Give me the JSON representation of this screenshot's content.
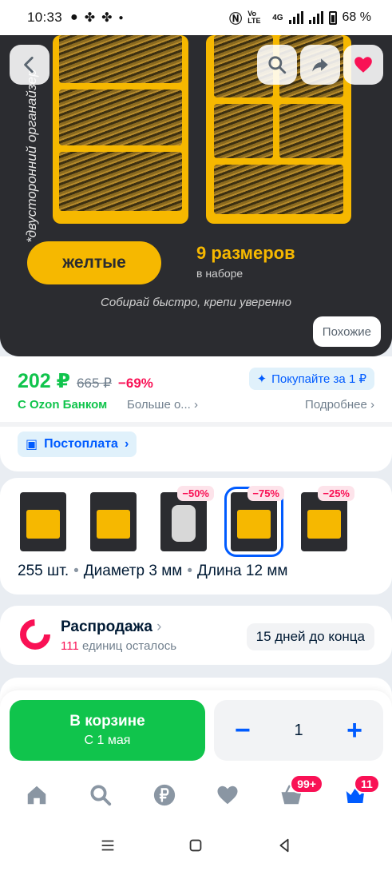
{
  "status_bar": {
    "time": "10:33",
    "battery": "68 %",
    "network": "4G",
    "volte": "Vo LTE"
  },
  "hero": {
    "side_text": "*двусторонний органайзер",
    "color_label": "желтые",
    "sizes_title": "9 размеров",
    "sizes_sub": "в наборе",
    "tagline": "Собирай быстро, крепи уверенно",
    "similar_button": "Похожие",
    "icons": [
      "back-icon",
      "search-icon",
      "share-icon",
      "favorite-heart-icon"
    ]
  },
  "price": {
    "current": "202 ₽",
    "old": "665 ₽",
    "discount": "−69%",
    "promo_button": "Покупайте за 1 ₽",
    "bank_label": "С Ozon Банком",
    "bank_more": "Больше о...",
    "details_link": "Подробнее",
    "postpay_button": "Постоплата"
  },
  "variants": {
    "thumbs": [
      {
        "badge": "",
        "kind": "yellow-box"
      },
      {
        "badge": "",
        "kind": "yellow-box"
      },
      {
        "badge": "−50%",
        "kind": "white-jar"
      },
      {
        "badge": "−75%",
        "kind": "yellow-box",
        "selected": true
      },
      {
        "badge": "−25%",
        "kind": "yellow-box"
      }
    ],
    "spec_count": "255 шт.",
    "spec_diameter": "Диаметр 3 мм",
    "spec_length": "Длина 12 мм"
  },
  "sale": {
    "title": "Распродажа",
    "remaining_count": "111",
    "remaining_text": "единиц осталось",
    "days_left": "15 дней до конца"
  },
  "actions": {
    "cart_label": "В корзине",
    "cart_sub": "С 1 мая",
    "quantity": "1",
    "minus": "−",
    "plus": "+"
  },
  "bottom_nav": {
    "cart_badge": "99+",
    "profile_badge": "11",
    "items": [
      "home-icon",
      "search-icon",
      "ruble-icon",
      "favorites-icon",
      "cart-icon",
      "profile-crown-icon"
    ]
  },
  "colors": {
    "accent_blue": "#005bff",
    "green": "#10c44c",
    "pink": "#f91155",
    "product_yellow": "#f6b800"
  }
}
